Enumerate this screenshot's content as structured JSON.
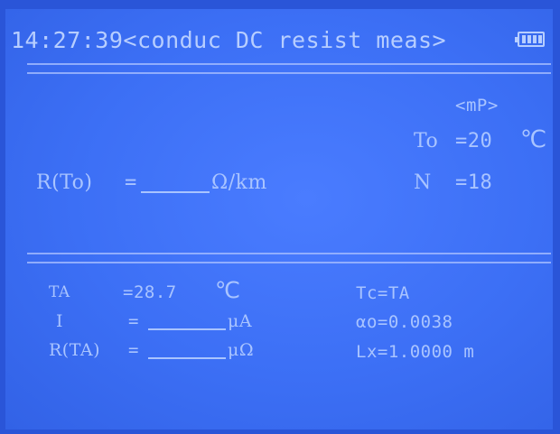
{
  "header": {
    "time": "14:27:39",
    "title": "<conduc DC resist meas>"
  },
  "status": {
    "mode": "<mP>",
    "t0_label": "To",
    "t0_value": "=20",
    "t0_unit": "℃",
    "n_label": "N",
    "n_value": "=18"
  },
  "result": {
    "label": "R(To)",
    "eq": "=",
    "unit": "Ω/km"
  },
  "measurements": {
    "ta_label": "TA",
    "ta_value": "=28.7",
    "ta_unit": "℃",
    "i_label": "I",
    "i_eq": "=",
    "i_unit": "μA",
    "rta_label": "R(TA)",
    "rta_eq": "=",
    "rta_unit": "μΩ"
  },
  "params": {
    "tc": "Tc=TA",
    "alpha": "αo=0.0038",
    "lx": "Lx=1.0000 m"
  },
  "icons": [
    "battery-icon"
  ]
}
